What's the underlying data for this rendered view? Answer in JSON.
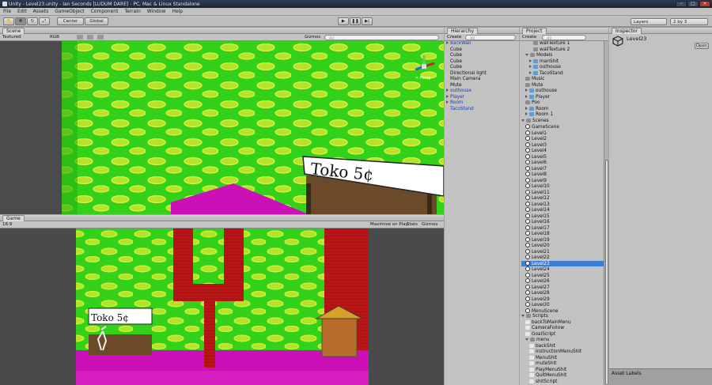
{
  "window": {
    "title": "Unity - Level23.unity - Ian Seconds [LUDUM DARE] - PC, Mac & Linux Standalone"
  },
  "menu": [
    "File",
    "Edit",
    "Assets",
    "GameObject",
    "Component",
    "Terrain",
    "Window",
    "Help"
  ],
  "toolbar": {
    "center": "Center",
    "global": "Global",
    "layers": "Layers",
    "layout": "2 by 3"
  },
  "scene": {
    "tab": "Scene",
    "shading": "Textured",
    "rgb": "RGB",
    "gizmos": "Gizmos",
    "search": "All",
    "persp": "< Persp"
  },
  "game": {
    "tab": "Game",
    "aspect": "16:9",
    "maximize": "Maximize on Play",
    "stats": "Stats",
    "gizmos": "Gizmos"
  },
  "sign": {
    "text": "Toko 5¢"
  },
  "hierarchy": {
    "tab": "Hierarchy",
    "create": "Create",
    "search": "All",
    "items": [
      {
        "label": "BackWall",
        "type": "blue"
      },
      {
        "label": "Cube",
        "type": "child"
      },
      {
        "label": "Cube",
        "type": "child"
      },
      {
        "label": "Cube",
        "type": "child"
      },
      {
        "label": "Cube",
        "type": "child"
      },
      {
        "label": "Directional light",
        "type": "child"
      },
      {
        "label": "Main Camera",
        "type": "child"
      },
      {
        "label": "Mute",
        "type": "child"
      },
      {
        "label": "outhouse",
        "type": "blue"
      },
      {
        "label": "Player",
        "type": "blue"
      },
      {
        "label": "Room",
        "type": "blue"
      },
      {
        "label": "TacoStand",
        "type": "blueflat"
      }
    ]
  },
  "project": {
    "tab": "Project",
    "create": "Create",
    "search": "All",
    "items": [
      {
        "label": "wallTexture 1",
        "indent": 3,
        "kind": "file"
      },
      {
        "label": "wallTexture 2",
        "indent": 3,
        "kind": "file"
      },
      {
        "label": "Models",
        "indent": 1,
        "kind": "folder"
      },
      {
        "label": "manShit",
        "indent": 2,
        "kind": "model"
      },
      {
        "label": "outhouse",
        "indent": 2,
        "kind": "model"
      },
      {
        "label": "TacoStand",
        "indent": 2,
        "kind": "model"
      },
      {
        "label": "Music",
        "indent": 1,
        "kind": "file"
      },
      {
        "label": "Mute",
        "indent": 1,
        "kind": "file"
      },
      {
        "label": "outhouse",
        "indent": 1,
        "kind": "model"
      },
      {
        "label": "Player",
        "indent": 1,
        "kind": "model"
      },
      {
        "label": "Poo",
        "indent": 1,
        "kind": "file"
      },
      {
        "label": "Room",
        "indent": 1,
        "kind": "model"
      },
      {
        "label": "Room 1",
        "indent": 1,
        "kind": "model"
      },
      {
        "label": "Scenes",
        "indent": 0,
        "kind": "folder"
      },
      {
        "label": "GameScene",
        "indent": 1,
        "kind": "scene"
      },
      {
        "label": "Level1",
        "indent": 1,
        "kind": "scene"
      },
      {
        "label": "Level2",
        "indent": 1,
        "kind": "scene"
      },
      {
        "label": "Level3",
        "indent": 1,
        "kind": "scene"
      },
      {
        "label": "Level4",
        "indent": 1,
        "kind": "scene"
      },
      {
        "label": "Level5",
        "indent": 1,
        "kind": "scene"
      },
      {
        "label": "Level6",
        "indent": 1,
        "kind": "scene"
      },
      {
        "label": "Level7",
        "indent": 1,
        "kind": "scene"
      },
      {
        "label": "Level8",
        "indent": 1,
        "kind": "scene"
      },
      {
        "label": "Level9",
        "indent": 1,
        "kind": "scene"
      },
      {
        "label": "Level10",
        "indent": 1,
        "kind": "scene"
      },
      {
        "label": "Level11",
        "indent": 1,
        "kind": "scene"
      },
      {
        "label": "Level12",
        "indent": 1,
        "kind": "scene"
      },
      {
        "label": "Level13",
        "indent": 1,
        "kind": "scene"
      },
      {
        "label": "Level14",
        "indent": 1,
        "kind": "scene"
      },
      {
        "label": "Level15",
        "indent": 1,
        "kind": "scene"
      },
      {
        "label": "Level16",
        "indent": 1,
        "kind": "scene"
      },
      {
        "label": "Level17",
        "indent": 1,
        "kind": "scene"
      },
      {
        "label": "Level18",
        "indent": 1,
        "kind": "scene"
      },
      {
        "label": "Level19",
        "indent": 1,
        "kind": "scene"
      },
      {
        "label": "Level20",
        "indent": 1,
        "kind": "scene"
      },
      {
        "label": "Level21",
        "indent": 1,
        "kind": "scene"
      },
      {
        "label": "Level22",
        "indent": 1,
        "kind": "scene"
      },
      {
        "label": "Level23",
        "indent": 1,
        "kind": "scene",
        "selected": true
      },
      {
        "label": "Level24",
        "indent": 1,
        "kind": "scene"
      },
      {
        "label": "Level25",
        "indent": 1,
        "kind": "scene"
      },
      {
        "label": "Level26",
        "indent": 1,
        "kind": "scene"
      },
      {
        "label": "Level27",
        "indent": 1,
        "kind": "scene"
      },
      {
        "label": "Level28",
        "indent": 1,
        "kind": "scene"
      },
      {
        "label": "Level29",
        "indent": 1,
        "kind": "scene"
      },
      {
        "label": "Level30",
        "indent": 1,
        "kind": "scene"
      },
      {
        "label": "MenuScene",
        "indent": 1,
        "kind": "scene"
      },
      {
        "label": "Scripts",
        "indent": 0,
        "kind": "folder"
      },
      {
        "label": "backToMainMenu",
        "indent": 1,
        "kind": "script"
      },
      {
        "label": "CameraFollow",
        "indent": 1,
        "kind": "script"
      },
      {
        "label": "GoalScript",
        "indent": 1,
        "kind": "script"
      },
      {
        "label": "menu",
        "indent": 1,
        "kind": "folder"
      },
      {
        "label": "backShit",
        "indent": 2,
        "kind": "script"
      },
      {
        "label": "InstructionMenuShit",
        "indent": 2,
        "kind": "script"
      },
      {
        "label": "MenuShit",
        "indent": 2,
        "kind": "script"
      },
      {
        "label": "muteShit",
        "indent": 2,
        "kind": "script"
      },
      {
        "label": "PlayMenuShit",
        "indent": 2,
        "kind": "script"
      },
      {
        "label": "QuitMenuShit",
        "indent": 2,
        "kind": "script"
      },
      {
        "label": "shitScript",
        "indent": 2,
        "kind": "script"
      }
    ]
  },
  "inspector": {
    "tab": "Inspector",
    "name": "Level23",
    "open": "Open",
    "asset_labels": "Asset Labels"
  }
}
